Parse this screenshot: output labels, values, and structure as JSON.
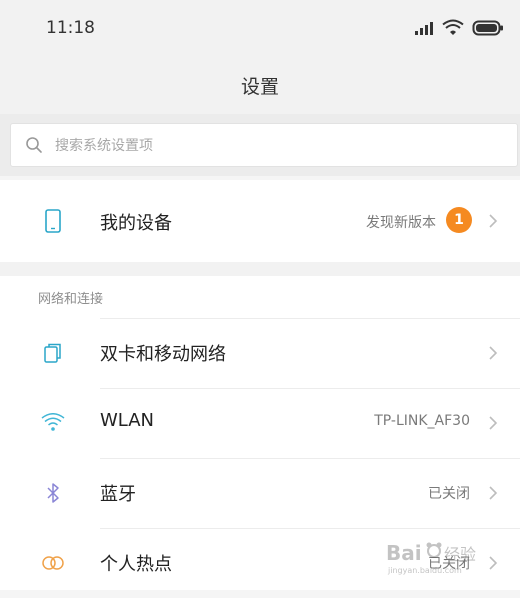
{
  "status_bar": {
    "time": "11:18",
    "signal_icon": "cellular-signal-icon",
    "wifi_icon": "wifi-icon",
    "battery_icon": "battery-icon"
  },
  "header": {
    "title": "设置"
  },
  "search": {
    "placeholder": "搜索系统设置项",
    "icon": "search-icon"
  },
  "device": {
    "label": "我的设备",
    "status": "发现新版本",
    "badge_count": "1",
    "icon": "phone-device-icon"
  },
  "network_section": {
    "header": "网络和连接",
    "items": [
      {
        "label": "双卡和移动网络",
        "value": "",
        "icon": "dual-sim-icon"
      },
      {
        "label": "WLAN",
        "value": "TP-LINK_AF30",
        "icon": "wifi-icon"
      },
      {
        "label": "蓝牙",
        "value": "已关闭",
        "icon": "bluetooth-icon"
      },
      {
        "label": "个人热点",
        "value": "已关闭",
        "icon": "hotspot-icon"
      }
    ]
  },
  "watermark": {
    "text": "Bai 经验"
  },
  "colors": {
    "accent_badge": "#f58a21",
    "icon_blue": "#2aa6c9",
    "icon_wifi": "#41b6d6",
    "icon_bluetooth": "#8a86d6",
    "icon_hotspot": "#f0a24a"
  }
}
